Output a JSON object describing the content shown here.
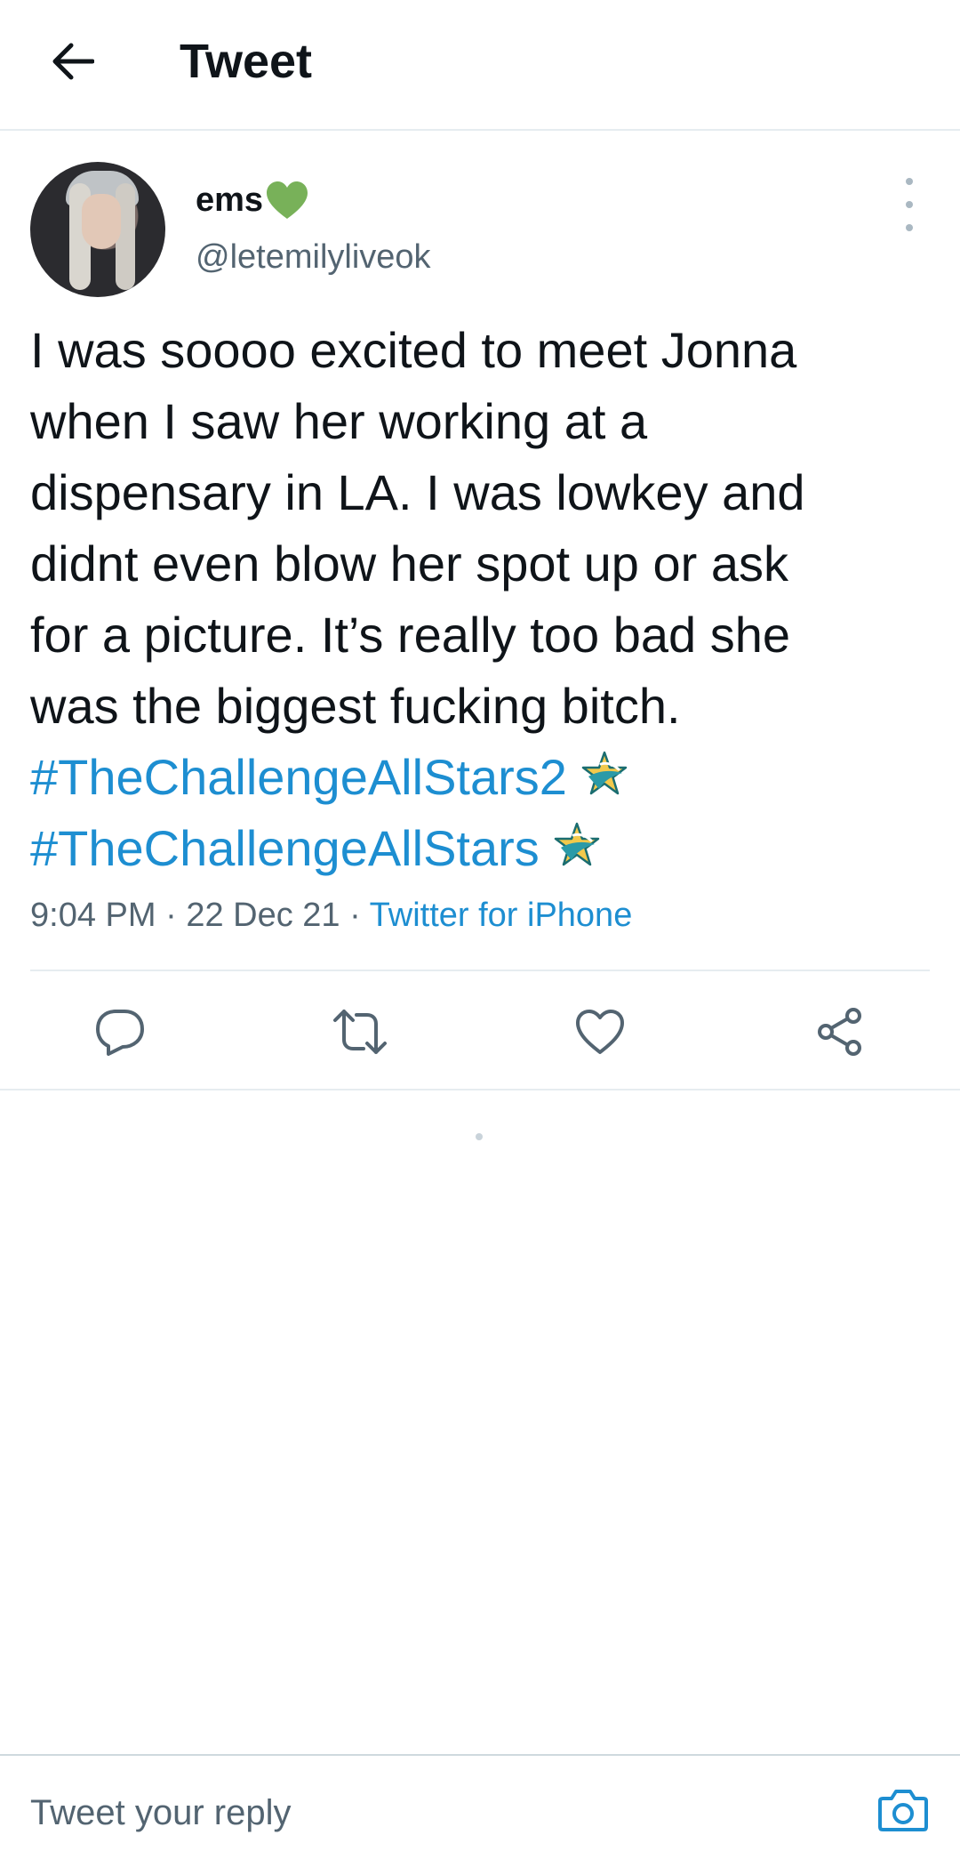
{
  "header": {
    "back_icon": "arrow-left-icon",
    "title": "Tweet"
  },
  "tweet": {
    "author": {
      "display_name": "ems",
      "name_emoji": "green-heart-icon",
      "handle": "@letemilyliveok"
    },
    "text_lines": [
      "I was soooo excited to meet Jonna",
      "when I saw her working at a",
      "dispensary in LA. I was lowkey and",
      "didnt even blow her spot up or ask",
      "for a picture. It’s really too bad she",
      "was the biggest fucking bitch."
    ],
    "hashtags": [
      "#TheChallengeAllStars2",
      "#TheChallengeAllStars"
    ],
    "time": "9:04 PM",
    "date": "22 Dec 21",
    "separator": "·",
    "source": "Twitter for iPhone"
  },
  "actions": [
    {
      "name": "reply",
      "icon": "reply-icon"
    },
    {
      "name": "retweet",
      "icon": "retweet-icon"
    },
    {
      "name": "like",
      "icon": "heart-outline-icon"
    },
    {
      "name": "share",
      "icon": "share-icon"
    }
  ],
  "reply_bar": {
    "placeholder": "Tweet your reply",
    "camera_icon": "camera-icon"
  },
  "colors": {
    "accent": "#1d8ed1",
    "text": "#0f1419",
    "secondary": "#536471",
    "border": "#e6ecf0",
    "heart_emoji": "#78b159"
  }
}
